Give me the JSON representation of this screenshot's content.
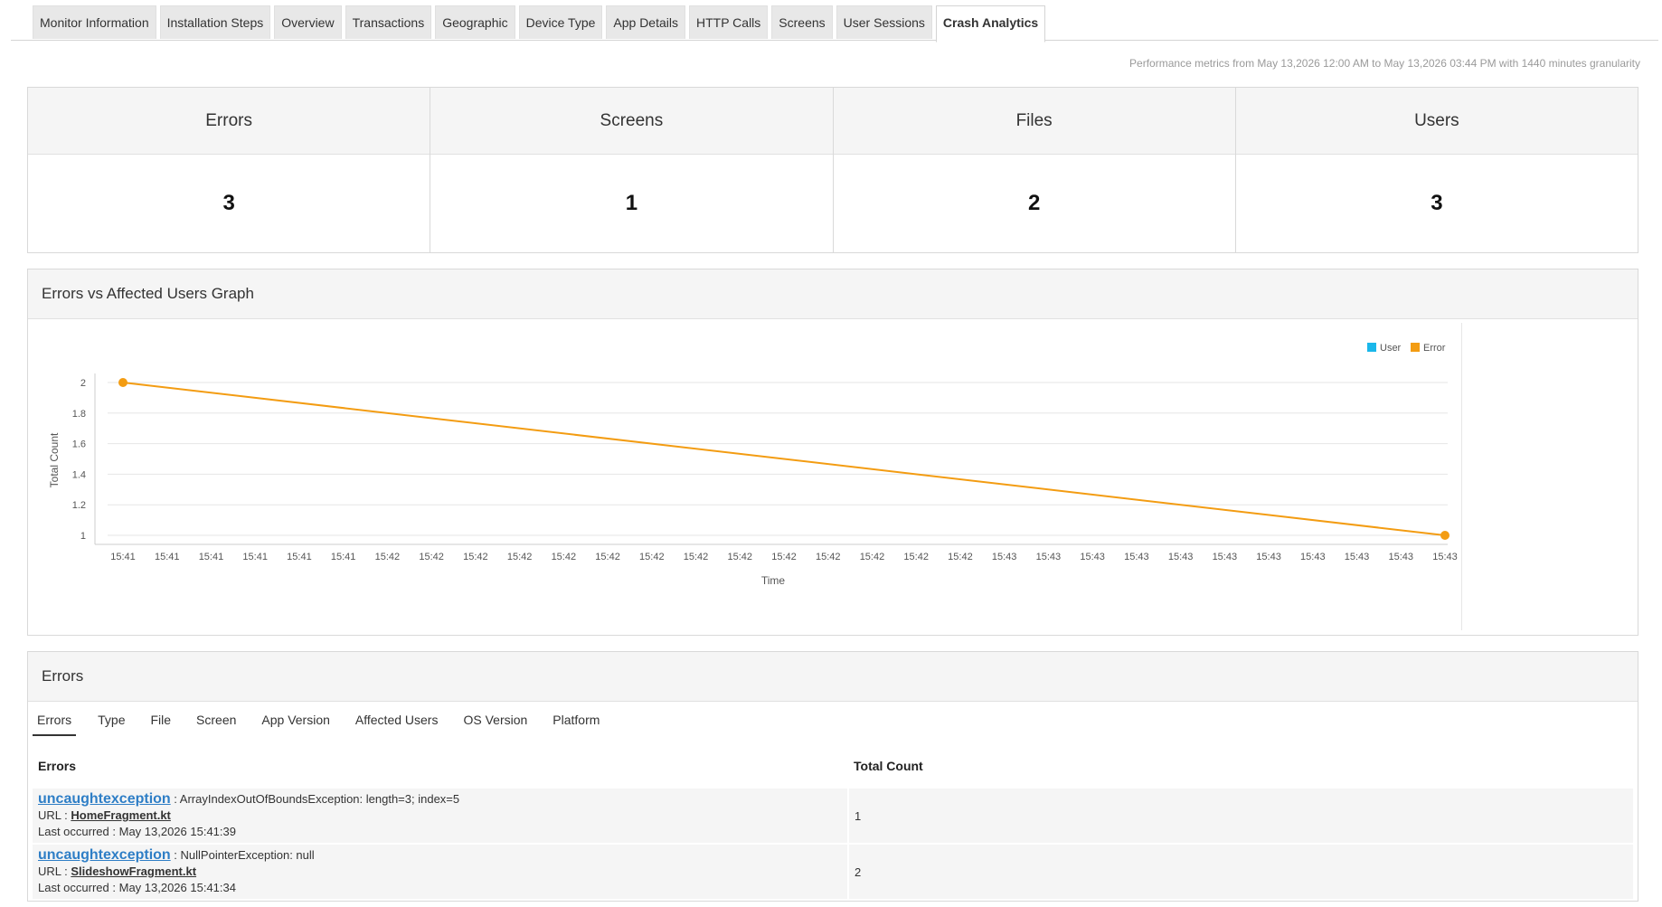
{
  "tabs": [
    {
      "label": "Monitor Information"
    },
    {
      "label": "Installation Steps"
    },
    {
      "label": "Overview"
    },
    {
      "label": "Transactions"
    },
    {
      "label": "Geographic"
    },
    {
      "label": "Device Type"
    },
    {
      "label": "App Details"
    },
    {
      "label": "HTTP Calls"
    },
    {
      "label": "Screens"
    },
    {
      "label": "User Sessions"
    },
    {
      "label": "Crash Analytics",
      "active": true
    }
  ],
  "perf_note": "Performance metrics from May 13,2026 12:00 AM to May 13,2026 03:44 PM with 1440 minutes granularity",
  "stats": [
    {
      "label": "Errors",
      "value": "3"
    },
    {
      "label": "Screens",
      "value": "1"
    },
    {
      "label": "Files",
      "value": "2"
    },
    {
      "label": "Users",
      "value": "3"
    }
  ],
  "graph": {
    "title": "Errors vs Affected Users Graph"
  },
  "chart_data": {
    "type": "line",
    "xlabel": "Time",
    "ylabel": "Total Count",
    "ylim": [
      1,
      2
    ],
    "yticks": [
      "2",
      "1.8",
      "1.6",
      "1.4",
      "1.2",
      "1"
    ],
    "xticks": [
      "15:41",
      "15:41",
      "15:41",
      "15:41",
      "15:41",
      "15:41",
      "15:42",
      "15:42",
      "15:42",
      "15:42",
      "15:42",
      "15:42",
      "15:42",
      "15:42",
      "15:42",
      "15:42",
      "15:42",
      "15:42",
      "15:42",
      "15:42",
      "15:43",
      "15:43",
      "15:43",
      "15:43",
      "15:43",
      "15:43",
      "15:43",
      "15:43",
      "15:43",
      "15:43",
      "15:43"
    ],
    "legend": [
      {
        "name": "User",
        "color": "#1ab7ea"
      },
      {
        "name": "Error",
        "color": "#f39c12"
      }
    ],
    "legend_position": "top-right",
    "grid": true,
    "series": [
      {
        "name": "Error",
        "color": "#f39c12",
        "points": [
          {
            "x": "15:41:34",
            "y": 2
          },
          {
            "x": "15:43",
            "y": 1
          }
        ]
      }
    ]
  },
  "errors_panel": {
    "title": "Errors",
    "subtabs": [
      "Errors",
      "Type",
      "File",
      "Screen",
      "App Version",
      "Affected Users",
      "OS Version",
      "Platform"
    ],
    "columns": [
      "Errors",
      "Total Count"
    ],
    "url_label": "URL : ",
    "last_label": "Last occurred : ",
    "rows": [
      {
        "type": "uncaughtexception",
        "message": " : ArrayIndexOutOfBoundsException: length=3; index=5",
        "file": "HomeFragment.kt",
        "last": "May 13,2026 15:41:39",
        "count": "1"
      },
      {
        "type": "uncaughtexception",
        "message": " : NullPointerException: null",
        "file": "SlideshowFragment.kt",
        "last": "May 13,2026 15:41:34",
        "count": "2"
      }
    ]
  }
}
